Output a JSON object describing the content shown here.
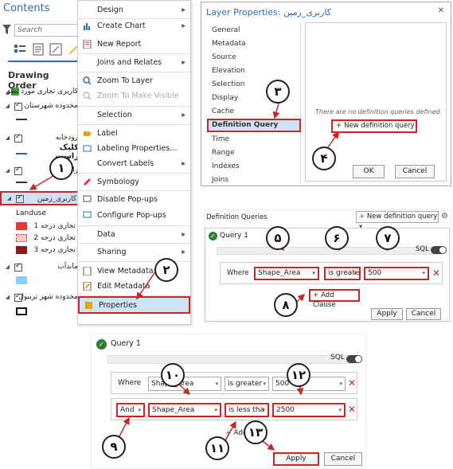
{
  "contents": {
    "title": "Contents",
    "search_placeholder": "Search",
    "drawing_order": "Drawing Order",
    "layers": [
      {
        "label": "کاربری تجاری مورد نظر",
        "checked": true
      },
      {
        "label": "محدوده شهرستان",
        "checked": true
      },
      {
        "label": "رودخانه",
        "checked": true
      },
      {
        "label": "راه آهن",
        "checked": true
      },
      {
        "label": "کاربری_زمین",
        "checked": true
      },
      {
        "label": "ماندآب",
        "checked": true
      },
      {
        "label": "محدوده شهر تربیول",
        "checked": true
      }
    ],
    "landuse_label": "Landuse",
    "legend": [
      {
        "label": "تجاری درجه 1",
        "color": "#e53935"
      },
      {
        "label": "تجاری درجه 2",
        "color": "#f8c9c9"
      },
      {
        "label": "تجاری درجه 3",
        "color": "#8b1a1a"
      }
    ],
    "right_click_note": "کلیک راست"
  },
  "menu": {
    "items": [
      "Design",
      "Create Chart",
      "New Report",
      "Joins and Relates",
      "Zoom To Layer",
      "Zoom To Make Visible",
      "Selection",
      "Label",
      "Labeling Properties...",
      "Convert Labels",
      "Symbology",
      "Disable Pop-ups",
      "Configure Pop-ups",
      "Data",
      "Sharing",
      "View Metadata",
      "Edit Metadata",
      "Properties"
    ]
  },
  "layer_props": {
    "title": "Layer Properties: کاربری_زمین",
    "close": "✕",
    "tabs": [
      "General",
      "Metadata",
      "Source",
      "Elevation",
      "Selection",
      "Display",
      "Cache",
      "Definition Query",
      "Time",
      "Range",
      "Indexes",
      "Joins"
    ],
    "empty_msg": "There are no definition queries defined.",
    "new_query": "New definition query",
    "ok": "OK",
    "cancel": "Cancel"
  },
  "def_queries": {
    "title": "Definition Queries",
    "new_query": "New definition query",
    "query_name": "Query 1",
    "sql": "SQL",
    "where": "Where",
    "field": "Shape_Area",
    "operator": "is greater",
    "value": "500",
    "add_clause": "Add Clause",
    "apply": "Apply",
    "cancel": "Cancel"
  },
  "query2": {
    "query_name": "Query 1",
    "sql": "SQL",
    "row1": {
      "where": "Where",
      "field": "Shape_Area",
      "operator": "is greater",
      "value": "500"
    },
    "row2": {
      "conj": "And",
      "field": "Shape_Area",
      "operator": "is less tha",
      "value": "2500"
    },
    "add_clause": "Add C",
    "apply": "Apply",
    "cancel": "Cancel"
  },
  "steps": [
    "۱",
    "۲",
    "۳",
    "۴",
    "۵",
    "۶",
    "۷",
    "۸",
    "۹",
    "۱۰",
    "۱۱",
    "۱۲",
    "۱۳"
  ],
  "colors": {
    "accent": "#2b6cb0",
    "highlight": "#c62828",
    "selected": "#cfe3f7"
  }
}
